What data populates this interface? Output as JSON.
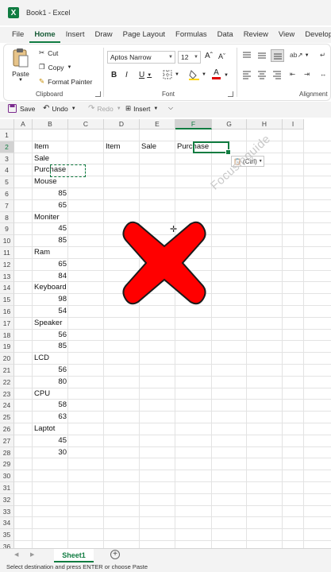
{
  "window": {
    "title": "Book1  -  Excel",
    "app_icon": "excel-logo-icon",
    "accent": "#107c41"
  },
  "ribbon_tabs": [
    "File",
    "Home",
    "Insert",
    "Draw",
    "Page Layout",
    "Formulas",
    "Data",
    "Review",
    "View",
    "Develop"
  ],
  "ribbon": {
    "clipboard": {
      "paste": "Paste",
      "cut": "Cut",
      "copy": "Copy",
      "format_painter": "Format Painter",
      "label": "Clipboard"
    },
    "font": {
      "name": "Aptos Narrow",
      "size": "12",
      "label": "Font",
      "bold": "B",
      "italic": "I",
      "underline": "U"
    },
    "alignment": {
      "label": "Alignment"
    }
  },
  "quick_access": {
    "save": "Save",
    "undo": "Undo",
    "redo": "Redo",
    "insert": "Insert"
  },
  "columns": [
    "A",
    "B",
    "C",
    "D",
    "E",
    "F",
    "G",
    "H",
    "I"
  ],
  "rows": [
    "1",
    "2",
    "3",
    "4",
    "5",
    "6",
    "7",
    "8",
    "9",
    "10",
    "11",
    "12",
    "13",
    "14",
    "15",
    "16",
    "17",
    "18",
    "19",
    "20",
    "21",
    "22",
    "23",
    "24",
    "25",
    "26",
    "27",
    "28",
    "29",
    "30",
    "31",
    "32",
    "33",
    "34",
    "35",
    "36"
  ],
  "cells": {
    "B2": "Item",
    "D2": "Item",
    "E2": "Sale",
    "F2": "Purchase",
    "B3": "Sale",
    "B4": "Purchase",
    "B5": "Mouse",
    "B6": "85",
    "B7": "65",
    "B8": "Moniter",
    "B9": "45",
    "B10": "85",
    "B11": "Ram",
    "B12": "65",
    "B13": "84",
    "B14": "Keyboard",
    "B15": "98",
    "B16": "54",
    "B17": "Speaker",
    "B18": "56",
    "B19": "85",
    "B20": "LCD",
    "B21": "56",
    "B22": "80",
    "B23": "CPU",
    "B24": "58",
    "B25": "63",
    "B26": "Laptot",
    "B27": "45",
    "B28": "30"
  },
  "paste_options": "(Ctrl)",
  "watermark": "Focusinguide",
  "overlay": {
    "shape": "red-x-mark-icon",
    "color": "#ff0000"
  },
  "sheet_tab": "Sheet1",
  "status_text": "Select destination and press ENTER or choose Paste"
}
